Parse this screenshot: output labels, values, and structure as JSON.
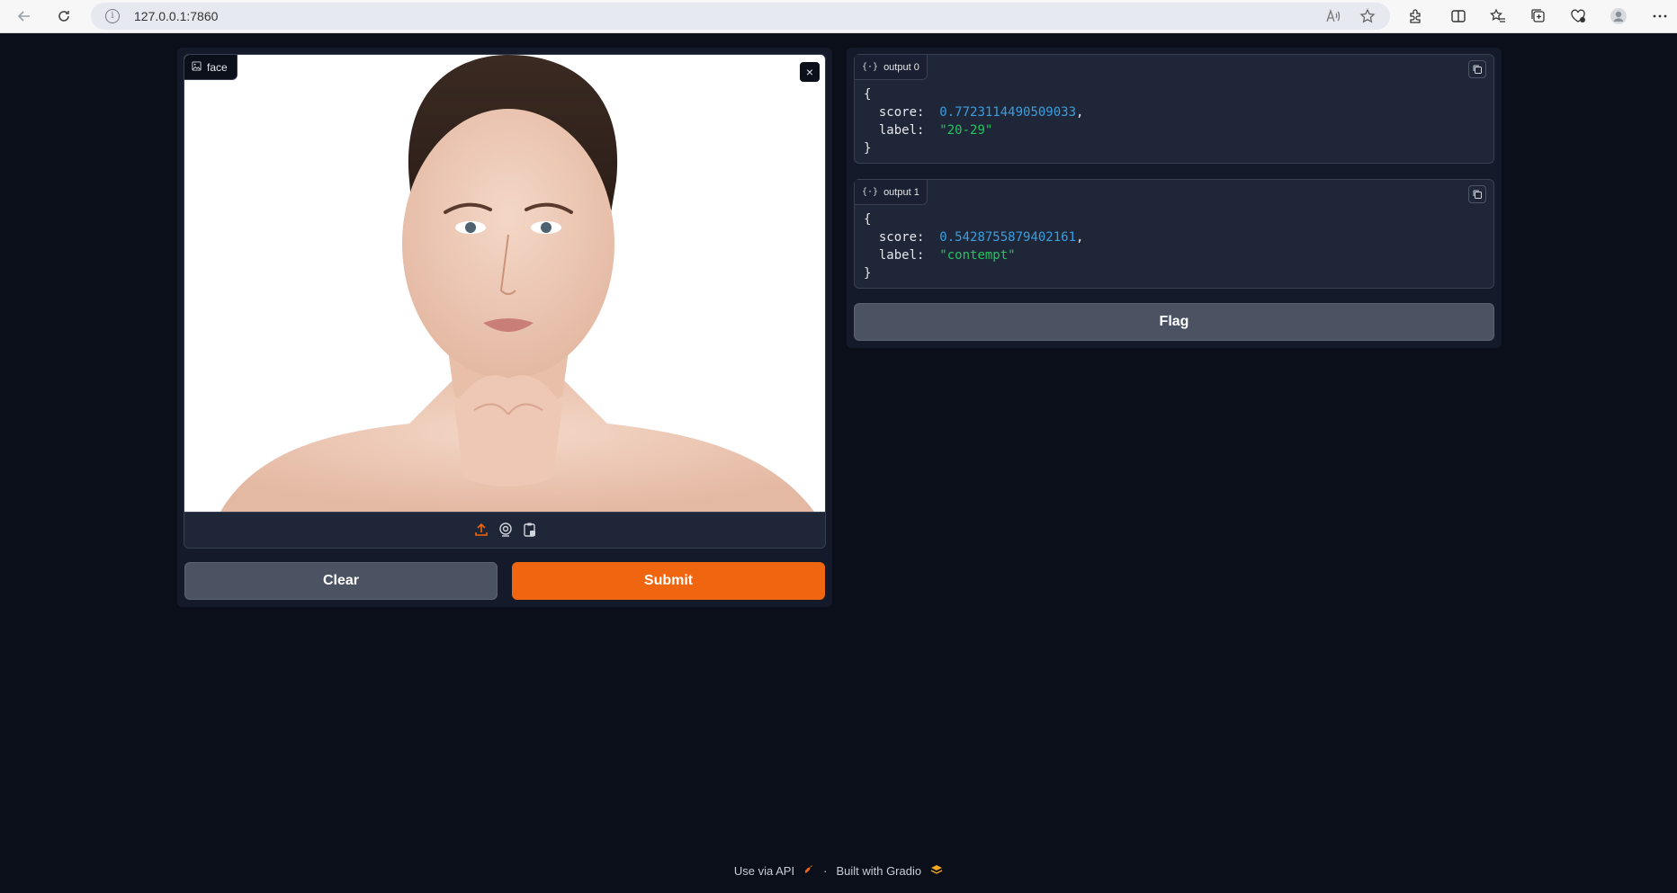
{
  "browser": {
    "url": "127.0.0.1:7860",
    "info_glyph": "i"
  },
  "input": {
    "label": "face",
    "close_glyph": "×"
  },
  "outputs": [
    {
      "label": "output 0",
      "open": "{",
      "close": "}",
      "score_key": "score:",
      "score": "0.7723114490509033",
      "score_sep": ",",
      "label_key": "label:",
      "label_value": "\"20-29\""
    },
    {
      "label": "output 1",
      "open": "{",
      "close": "}",
      "score_key": "score:",
      "score": "0.5428755879402161",
      "score_sep": ",",
      "label_key": "label:",
      "label_value": "\"contempt\""
    }
  ],
  "buttons": {
    "clear": "Clear",
    "submit": "Submit",
    "flag": "Flag"
  },
  "footer": {
    "api": "Use via API",
    "dot": "·",
    "built": "Built with Gradio"
  },
  "colors": {
    "accent": "#f0650f",
    "background": "#0b0f19",
    "number": "#3b9edf",
    "string": "#22c55e"
  },
  "icons": [
    "back-icon",
    "reload-icon",
    "info-icon",
    "read-aloud-icon",
    "favorite-star-icon",
    "extensions-icon",
    "split-screen-icon",
    "favorites-icon",
    "collections-icon",
    "performance-icon",
    "profile-icon",
    "more-icon",
    "image-icon",
    "close-icon",
    "upload-icon",
    "webcam-icon",
    "clipboard-icon",
    "json-icon",
    "copy-icon",
    "rocket-icon",
    "gradio-logo-icon"
  ]
}
